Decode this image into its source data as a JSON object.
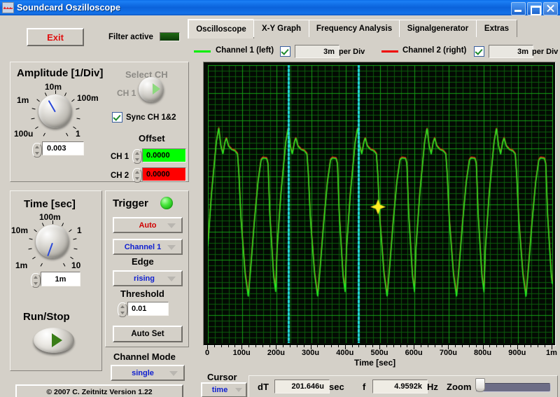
{
  "window": {
    "title": "Soundcard Oszilloscope",
    "icon": "waveform-icon",
    "buttons": {
      "minimize": "minimize-icon",
      "maximize": "maximize-icon",
      "close": "close-icon"
    }
  },
  "toolbar": {
    "exit_label": "Exit",
    "filter_label": "Filter active"
  },
  "amplitude": {
    "title": "Amplitude [1/Div]",
    "knob_labels": [
      "100u",
      "1m",
      "10m",
      "100m",
      "1"
    ],
    "value": "0.003",
    "select_ch_label": "Select CH",
    "ch_label": "CH 1",
    "sync_label": "Sync CH 1&2",
    "sync_checked": true,
    "offset_title": "Offset",
    "ch1_label": "CH 1",
    "ch1_offset": "0.0000",
    "ch1_color": "#00ff00",
    "ch2_label": "CH 2",
    "ch2_offset": "0.0000",
    "ch2_color": "#ff0000"
  },
  "time": {
    "title": "Time [sec]",
    "knob_labels": [
      "1m",
      "10m",
      "100m",
      "1",
      "10"
    ],
    "value": "1m",
    "run_stop_label": "Run/Stop"
  },
  "trigger": {
    "title": "Trigger",
    "led_color": "#22dd22",
    "mode": "Auto",
    "mode_color": "#d00000",
    "source": "Channel 1",
    "source_color": "#1020d0",
    "edge_label": "Edge",
    "edge": "rising",
    "edge_color": "#1020d0",
    "threshold_label": "Threshold",
    "threshold": "0.01",
    "auto_set_label": "Auto Set",
    "channel_mode_label": "Channel Mode",
    "channel_mode": "single",
    "channel_mode_color": "#1020d0"
  },
  "copyright": "© 2007   C. Zeitnitz Version 1.22",
  "tabs": [
    {
      "label": "Oscilloscope",
      "selected": true
    },
    {
      "label": "X-Y Graph",
      "selected": false
    },
    {
      "label": "Frequency Analysis",
      "selected": false
    },
    {
      "label": "Signalgenerator",
      "selected": false
    },
    {
      "label": "Extras",
      "selected": false
    }
  ],
  "channels": [
    {
      "label": "Channel 1 (left)",
      "color": "#00ee00",
      "enabled": true,
      "per_div": "3m",
      "per_div_unit": "per Div"
    },
    {
      "label": "Channel 2 (right)",
      "color": "#ee0000",
      "enabled": true,
      "per_div": "3m",
      "per_div_unit": "per Div"
    }
  ],
  "cursor": {
    "title": "Cursor",
    "mode": "time",
    "mode_color": "#1020d0",
    "dt_label": "dT",
    "dt_value": "201.646u",
    "dt_unit": "sec",
    "f_label": "f",
    "f_value": "4.9592k",
    "f_unit": "Hz",
    "zoom_label": "Zoom",
    "zoom_position": 2
  },
  "chart_data": {
    "type": "line",
    "title": "",
    "xlabel": "Time [sec]",
    "ylabel": "",
    "grid": true,
    "xlim": [
      0,
      0.001
    ],
    "ylim": [
      -1,
      1
    ],
    "xtick_labels": [
      "0",
      "100u",
      "200u",
      "300u",
      "400u",
      "500u",
      "600u",
      "700u",
      "800u",
      "900u",
      "1m"
    ],
    "xtick_values": [
      0,
      0.0001,
      0.0002,
      0.0003,
      0.0004,
      0.0005,
      0.0006,
      0.0007,
      0.0008,
      0.0009,
      0.001
    ],
    "bg_color": "#030a03",
    "grid_color_major": "#159e15",
    "grid_color_minor": "#0c5c0c",
    "cursor_lines": {
      "color": "#25e0e0",
      "style": "dotted",
      "x_positions": [
        0.000234,
        0.000436
      ]
    },
    "cursor_marker": {
      "color": "#ffee22",
      "x": 0.000494,
      "y": -0.02
    },
    "waveform_period": 0.0002016,
    "waveform_phase": 4.2e-05,
    "series": [
      {
        "name": "Channel 1 (left)",
        "color": "#22ee22",
        "amplitude": 0.72,
        "offset": 0.0
      },
      {
        "name": "Channel 2 (right)",
        "color": "#ee2211",
        "amplitude": 0.71,
        "offset": 0.012
      }
    ],
    "waveform_shape_points": [
      [
        0.0,
        0.46
      ],
      [
        0.055,
        0.455
      ],
      [
        0.075,
        0.4
      ],
      [
        0.1,
        -0.1
      ],
      [
        0.155,
        -0.72
      ],
      [
        0.185,
        -0.88
      ],
      [
        0.205,
        -0.45
      ],
      [
        0.26,
        0.1
      ],
      [
        0.33,
        0.62
      ],
      [
        0.365,
        0.76
      ],
      [
        0.395,
        0.58
      ],
      [
        0.425,
        0.5
      ],
      [
        0.455,
        0.62
      ],
      [
        0.475,
        0.66
      ],
      [
        0.505,
        0.58
      ],
      [
        0.55,
        0.545
      ],
      [
        0.6,
        0.53
      ],
      [
        0.635,
        0.5
      ],
      [
        0.655,
        0.3
      ],
      [
        0.685,
        -0.15
      ],
      [
        0.745,
        -0.7
      ],
      [
        0.79,
        -0.93
      ],
      [
        0.83,
        -0.6
      ],
      [
        0.875,
        -0.2
      ],
      [
        0.93,
        0.22
      ],
      [
        0.975,
        0.44
      ],
      [
        1.0,
        0.46
      ]
    ]
  }
}
